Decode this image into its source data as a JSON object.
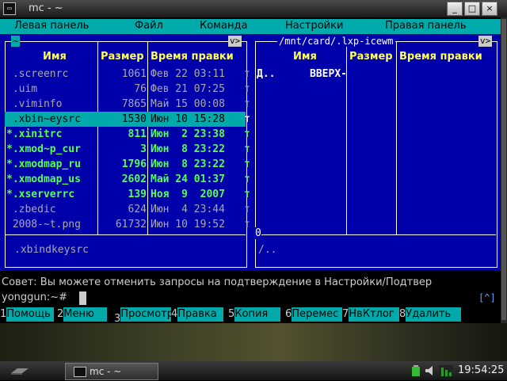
{
  "window": {
    "title": "mc - ~",
    "minimize": "_",
    "maximize": "□",
    "close": "×"
  },
  "menu": [
    "Левая панель",
    "Файл",
    "Команда",
    "Настройки",
    "Правая панель"
  ],
  "left_panel": {
    "path": "~",
    "tag": "v>",
    "headers": {
      "name": "Имя",
      "size": "Размер",
      "time": "Время правки"
    },
    "rows": [
      {
        "name": " .screenrc",
        "size": "1061",
        "time": "Фев 22 03:11",
        "mark": "т"
      },
      {
        "name": " .uim",
        "size": "76",
        "time": "Фев 21 07:25",
        "mark": "т"
      },
      {
        "name": " .viminfo",
        "size": "7865",
        "time": "Май 15 00:08",
        "mark": "т"
      },
      {
        "name": " .xbin~eysrc",
        "size": "1530",
        "time": "Июн 10 15:28",
        "mark": "т"
      },
      {
        "name": "*.xinitrc",
        "size": "811",
        "time": "Июн  2 23:38",
        "mark": "т"
      },
      {
        "name": "*.xmod~p_cur",
        "size": "3",
        "time": "Июн  8 23:22",
        "mark": "т"
      },
      {
        "name": "*.xmodmap_ru",
        "size": "1796",
        "time": "Июн  8 23:22",
        "mark": "т"
      },
      {
        "name": "*.xmodmap_us",
        "size": "2602",
        "time": "Май 24 01:37",
        "mark": "т"
      },
      {
        "name": "*.xserverrc",
        "size": "139",
        "time": "Ноя  9  2007",
        "mark": "т"
      },
      {
        "name": " .zbedic",
        "size": "624",
        "time": "Июн  4 23:44",
        "mark": "т"
      },
      {
        "name": " 2008-~t.png",
        "size": "61732",
        "time": "Июн 10 19:52",
        "mark": "т"
      }
    ],
    "mini_status": ".xbindkeysrc"
  },
  "right_panel": {
    "path": "/mnt/card/.lxp-icewm",
    "tag": "v>",
    "headers": {
      "name": "Имя",
      "size": "Размер",
      "time": "Время правки"
    },
    "rows": [
      {
        "name": "Д..",
        "size": "ВВЕРХ-",
        "time": ""
      }
    ],
    "mini_status": "/..",
    "free": "0"
  },
  "hint": "Совет: Вы можете отменить запросы на подтверждение в Настройки/Подтвер",
  "prompt": "yonggun:~#",
  "expand_indicator": "[^]",
  "fkeys": [
    {
      "n": "1",
      "l": "Помощь"
    },
    {
      "n": "2",
      "l": "Меню"
    },
    {
      "n": "3",
      "l": "Просмотр"
    },
    {
      "n": "4",
      "l": "Правка"
    },
    {
      "n": "5",
      "l": "Копия"
    },
    {
      "n": "6",
      "l": "Перемес"
    },
    {
      "n": "7",
      "l": "НвКтлог"
    },
    {
      "n": "8",
      "l": "Удалить"
    }
  ],
  "taskbar": {
    "task_title": "mc - ~",
    "clock": "19:54:25"
  },
  "colors": {
    "panel_bg": "#0000aa",
    "cyan": "#00aaaa",
    "exec_green": "#55ff55",
    "header_yellow": "#ffff55"
  }
}
